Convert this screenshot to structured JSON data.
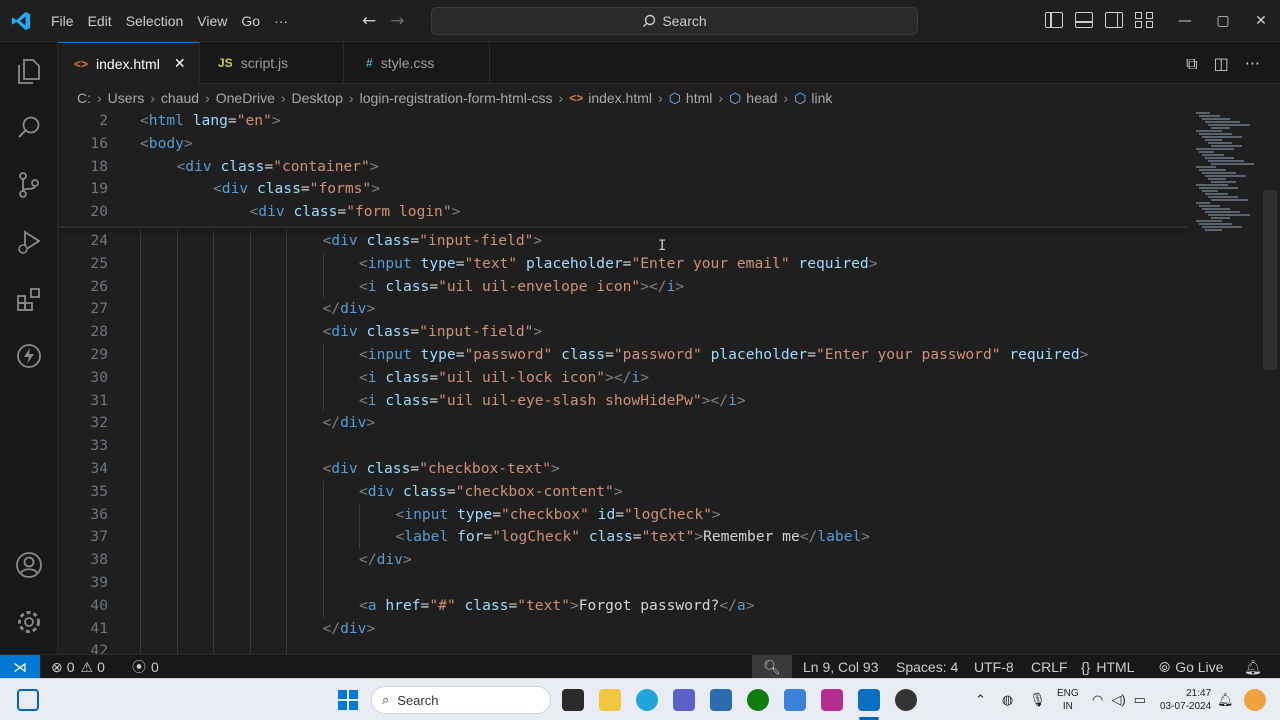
{
  "menu": [
    "File",
    "Edit",
    "Selection",
    "View",
    "Go",
    "···"
  ],
  "search": {
    "label": "Search"
  },
  "tabs": [
    {
      "label": "index.html",
      "icon": "<>",
      "close": "✕"
    },
    {
      "label": "script.js",
      "icon": "JS"
    },
    {
      "label": "style.css",
      "icon": "#"
    }
  ],
  "breadcrumb": [
    "C:",
    "Users",
    "chaud",
    "OneDrive",
    "Desktop",
    "login-registration-form-html-css",
    "index.html",
    "html",
    "head",
    "link"
  ],
  "editor": {
    "lines": [
      {
        "n": "2",
        "indent": 0,
        "html": "<span class='t'>&lt;</span><span class='n'>html</span> <span class='a'>lang</span><span class='x'>=</span><span class='v'>\"en\"</span><span class='t'>&gt;</span>"
      },
      {
        "n": "16",
        "indent": 0,
        "html": "<span class='t'>&lt;</span><span class='n'>body</span><span class='t'>&gt;</span>"
      },
      {
        "n": "18",
        "indent": 1,
        "html": "<span class='t'>&lt;</span><span class='n'>div</span> <span class='a'>class</span><span class='x'>=</span><span class='v'>\"container\"</span><span class='t'>&gt;</span>"
      },
      {
        "n": "19",
        "indent": 2,
        "html": "<span class='t'>&lt;</span><span class='n'>div</span> <span class='a'>class</span><span class='x'>=</span><span class='v'>\"forms\"</span><span class='t'>&gt;</span>"
      },
      {
        "n": "20",
        "indent": 3,
        "html": "<span class='t'>&lt;</span><span class='n'>div</span> <span class='a'>class</span><span class='x'>=</span><span class='v'>\"form login\"</span><span class='t'>&gt;</span>"
      },
      {
        "n": "24",
        "indent": 5,
        "html": "<span class='t'>&lt;</span><span class='n'>div</span> <span class='a'>class</span><span class='x'>=</span><span class='v'>\"input-field\"</span><span class='t'>&gt;</span>"
      },
      {
        "n": "25",
        "indent": 6,
        "html": "<span class='t'>&lt;</span><span class='n'>input</span> <span class='a'>type</span><span class='x'>=</span><span class='v'>\"text\"</span> <span class='a'>placeholder</span><span class='x'>=</span><span class='v'>\"Enter your email\"</span> <span class='a'>required</span><span class='t'>&gt;</span>"
      },
      {
        "n": "26",
        "indent": 6,
        "html": "<span class='t'>&lt;</span><span class='n'>i</span> <span class='a'>class</span><span class='x'>=</span><span class='v'>\"uil uil-envelope icon\"</span><span class='t'>&gt;&lt;/</span><span class='n'>i</span><span class='t'>&gt;</span>"
      },
      {
        "n": "27",
        "indent": 5,
        "html": "<span class='t'>&lt;/</span><span class='n'>div</span><span class='t'>&gt;</span>"
      },
      {
        "n": "28",
        "indent": 5,
        "html": "<span class='t'>&lt;</span><span class='n'>div</span> <span class='a'>class</span><span class='x'>=</span><span class='v'>\"input-field\"</span><span class='t'>&gt;</span>"
      },
      {
        "n": "29",
        "indent": 6,
        "html": "<span class='t'>&lt;</span><span class='n'>input</span> <span class='a'>type</span><span class='x'>=</span><span class='v'>\"password\"</span> <span class='a'>class</span><span class='x'>=</span><span class='v'>\"password\"</span> <span class='a'>placeholder</span><span class='x'>=</span><span class='v'>\"Enter your password\"</span> <span class='a'>required</span><span class='t'>&gt;</span>"
      },
      {
        "n": "30",
        "indent": 6,
        "html": "<span class='t'>&lt;</span><span class='n'>i</span> <span class='a'>class</span><span class='x'>=</span><span class='v'>\"uil uil-lock icon\"</span><span class='t'>&gt;&lt;/</span><span class='n'>i</span><span class='t'>&gt;</span>"
      },
      {
        "n": "31",
        "indent": 6,
        "html": "<span class='t'>&lt;</span><span class='n'>i</span> <span class='a'>class</span><span class='x'>=</span><span class='v'>\"uil uil-eye-slash showHidePw\"</span><span class='t'>&gt;&lt;/</span><span class='n'>i</span><span class='t'>&gt;</span>"
      },
      {
        "n": "32",
        "indent": 5,
        "html": "<span class='t'>&lt;/</span><span class='n'>div</span><span class='t'>&gt;</span>"
      },
      {
        "n": "33",
        "indent": 5,
        "html": ""
      },
      {
        "n": "34",
        "indent": 5,
        "html": "<span class='t'>&lt;</span><span class='n'>div</span> <span class='a'>class</span><span class='x'>=</span><span class='v'>\"checkbox-text\"</span><span class='t'>&gt;</span>"
      },
      {
        "n": "35",
        "indent": 6,
        "html": "<span class='t'>&lt;</span><span class='n'>div</span> <span class='a'>class</span><span class='x'>=</span><span class='v'>\"checkbox-content\"</span><span class='t'>&gt;</span>"
      },
      {
        "n": "36",
        "indent": 7,
        "html": "<span class='t'>&lt;</span><span class='n'>input</span> <span class='a'>type</span><span class='x'>=</span><span class='v'>\"checkbox\"</span> <span class='a'>id</span><span class='x'>=</span><span class='v'>\"logCheck\"</span><span class='t'>&gt;</span>"
      },
      {
        "n": "37",
        "indent": 7,
        "html": "<span class='t'>&lt;</span><span class='n'>label</span> <span class='a'>for</span><span class='x'>=</span><span class='v'>\"logCheck\"</span> <span class='a'>class</span><span class='x'>=</span><span class='v'>\"text\"</span><span class='t'>&gt;</span><span class='x'>Remember me</span><span class='t'>&lt;/</span><span class='n'>label</span><span class='t'>&gt;</span>"
      },
      {
        "n": "38",
        "indent": 6,
        "html": "<span class='t'>&lt;/</span><span class='n'>div</span><span class='t'>&gt;</span>"
      },
      {
        "n": "39",
        "indent": 6,
        "html": ""
      },
      {
        "n": "40",
        "indent": 6,
        "html": "<span class='t'>&lt;</span><span class='n'>a</span> <span class='a'>href</span><span class='x'>=</span><span class='v'>\"#\"</span> <span class='a'>class</span><span class='x'>=</span><span class='v'>\"text\"</span><span class='t'>&gt;</span><span class='x'>Forgot password?</span><span class='t'>&lt;/</span><span class='n'>a</span><span class='t'>&gt;</span>"
      },
      {
        "n": "41",
        "indent": 5,
        "html": "<span class='t'>&lt;/</span><span class='n'>div</span><span class='t'>&gt;</span>"
      },
      {
        "n": "42",
        "indent": 5,
        "html": ""
      }
    ]
  },
  "status": {
    "errors": "0",
    "warnings": "0",
    "ports": "0",
    "position": "Ln 9, Col 93",
    "spaces": "Spaces: 4",
    "encoding": "UTF-8",
    "eol": "CRLF",
    "language": "HTML",
    "golive": "Go Live"
  },
  "taskbar": {
    "search": "Search",
    "lang_top": "ENG",
    "lang_bottom": "IN",
    "time": "21:47",
    "date": "03-07-2024"
  },
  "colors": {
    "accent": "#0078d4",
    "tag": "#569cd6",
    "attr": "#9cdcfe",
    "string": "#ce9178"
  }
}
